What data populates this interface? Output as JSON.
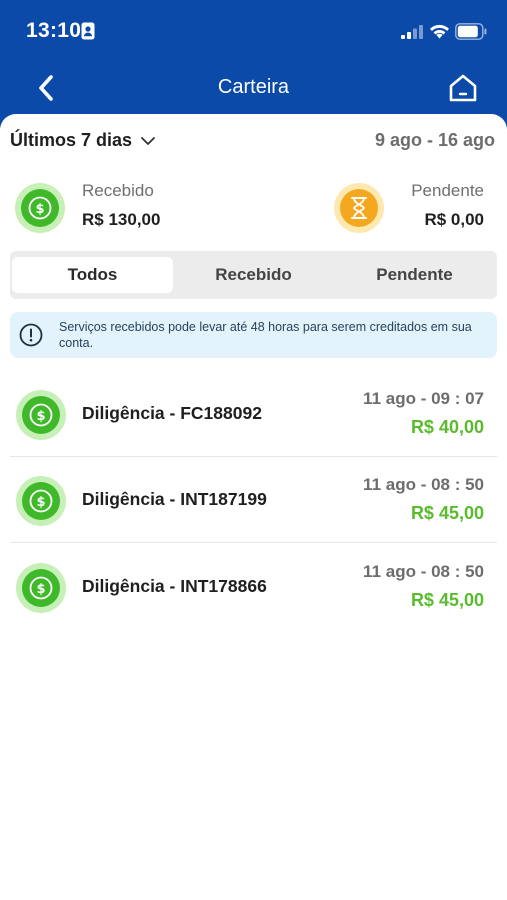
{
  "status_bar": {
    "time": "13:10",
    "icons": [
      "id-card-icon",
      "signal-icon",
      "wifi-icon",
      "battery-icon"
    ]
  },
  "header": {
    "title": "Carteira",
    "back_icon": "chevron-left-icon",
    "home_icon": "home-icon",
    "background_color": "#0b4aa8"
  },
  "filter": {
    "period_label": "Últimos 7 dias",
    "date_range": "9 ago - 16 ago"
  },
  "summary": {
    "received": {
      "label": "Recebido",
      "value": "R$ 130,00",
      "icon": "dollar-coin-icon",
      "color": "#3fb82a"
    },
    "pending": {
      "label": "Pendente",
      "value": "R$ 0,00",
      "icon": "hourglass-icon",
      "color": "#f3a820"
    }
  },
  "tabs": [
    {
      "label": "Todos",
      "active": true
    },
    {
      "label": "Recebido",
      "active": false
    },
    {
      "label": "Pendente",
      "active": false
    }
  ],
  "info_banner": {
    "text": "Serviços recebidos pode levar até 48 horas para serem creditados em sua conta.",
    "icon": "info-icon"
  },
  "transactions": [
    {
      "title": "Diligência - FC188092",
      "date": "11 ago - 09 : 07",
      "amount": "R$ 40,00"
    },
    {
      "title": "Diligência - INT187199",
      "date": "11 ago - 08 : 50",
      "amount": "R$ 45,00"
    },
    {
      "title": "Diligência - INT178866",
      "date": "11 ago - 08 : 50",
      "amount": "R$ 45,00"
    }
  ],
  "colors": {
    "accent_green": "#5abb2c",
    "banner_background": "#e3f3fb"
  }
}
